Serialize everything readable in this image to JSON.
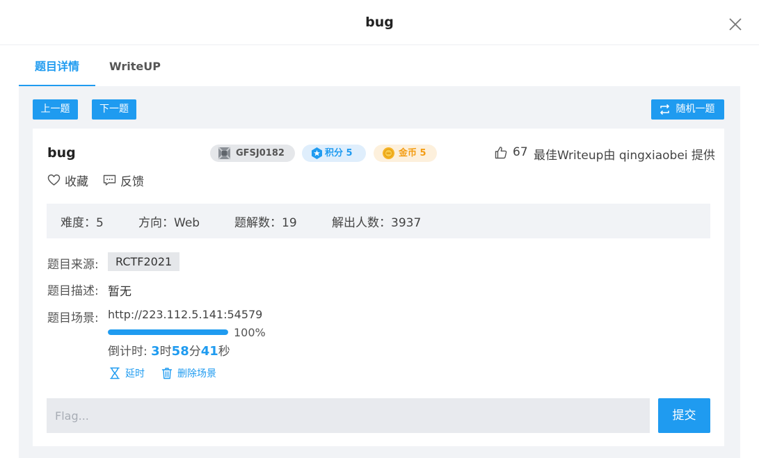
{
  "modal": {
    "title": "bug"
  },
  "tabs": [
    {
      "label": "题目详情",
      "active": true
    },
    {
      "label": "WriteUP",
      "active": false
    }
  ],
  "toolbar": {
    "prev_label": "上一题",
    "next_label": "下一题",
    "random_label": "随机一题",
    "random_icon": "shuffle-icon"
  },
  "challenge": {
    "name": "bug",
    "id_tag": "GFSJ0182",
    "score_tag": "积分 5",
    "coin_tag": "金币 5",
    "likes": "67",
    "best_writeup": "最佳Writeup由 qingxiaobei 提供",
    "favorite_label": "收藏",
    "feedback_label": "反馈"
  },
  "stats": {
    "difficulty": "难度：5",
    "direction": "方向：Web",
    "solves": "题解数：19",
    "solvers": "解出人数：3937"
  },
  "details": {
    "source_label": "题目来源:",
    "source_value": "RCTF2021",
    "desc_label": "题目描述:",
    "desc_value": "暂无",
    "scene_label": "题目场景:",
    "scene_url": "http://223.112.5.141:54579",
    "progress_percent": 100,
    "progress_text": "100%",
    "countdown_prefix": "倒计时: ",
    "hours": "3",
    "hours_unit": "时",
    "minutes": "58",
    "minutes_unit": "分",
    "seconds": "41",
    "seconds_unit": "秒",
    "extend_label": "延时",
    "delete_label": "删除场景"
  },
  "flag": {
    "placeholder": "Flag...",
    "value": "",
    "submit_label": "提交"
  },
  "colors": {
    "accent": "#1f9bf0",
    "coin": "#f39c12",
    "panel_bg": "#f1f3f6"
  }
}
